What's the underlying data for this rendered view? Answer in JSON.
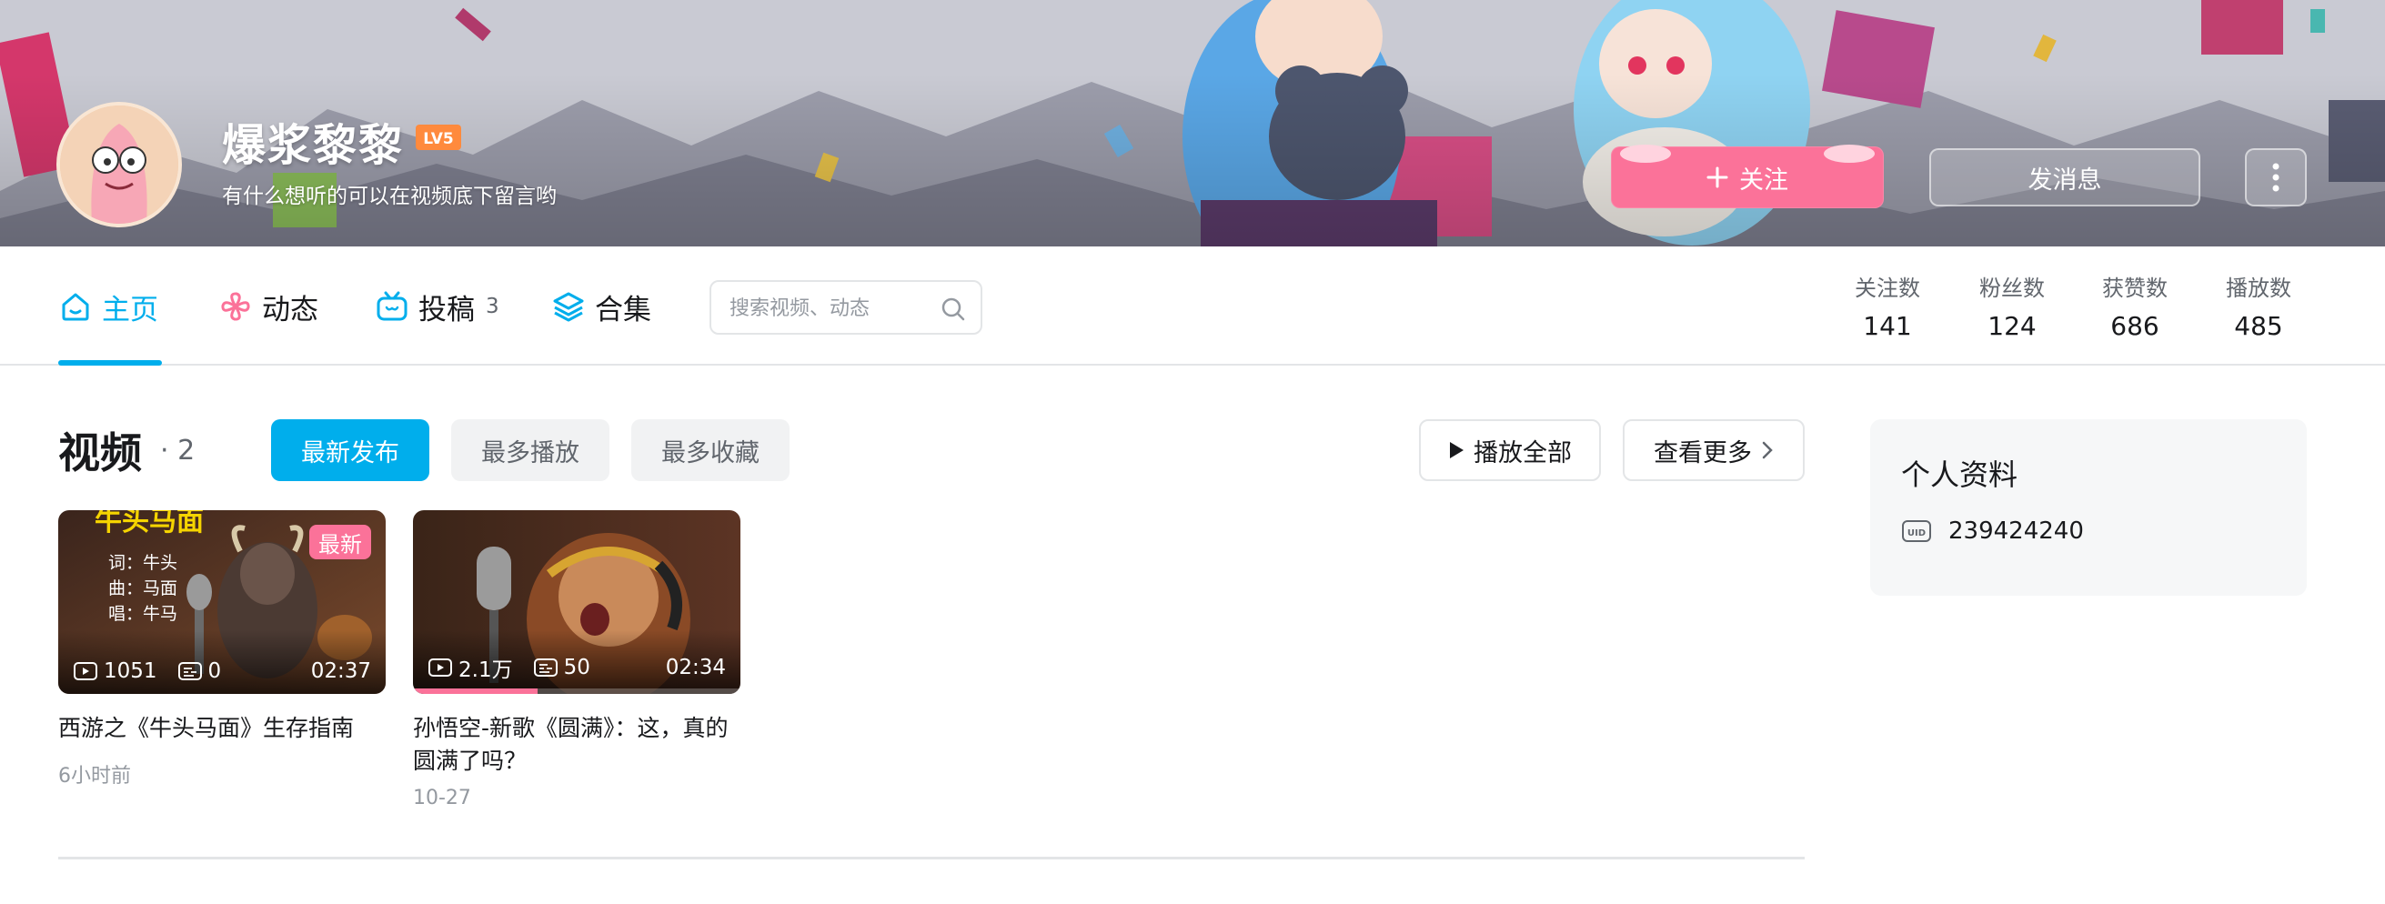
{
  "header": {
    "username": "爆浆黎黎",
    "level": "LV5",
    "signature": "有什么想听的可以在视频底下留言哟",
    "follow_label": "关注",
    "message_label": "发消息"
  },
  "nav": {
    "tabs": [
      {
        "label": "主页",
        "icon": "home-icon"
      },
      {
        "label": "动态",
        "icon": "pinwheel-icon"
      },
      {
        "label": "投稿",
        "icon": "tv-icon",
        "count": "3"
      },
      {
        "label": "合集",
        "icon": "layers-icon"
      }
    ],
    "search_placeholder": "搜索视频、动态",
    "stats": [
      {
        "label": "关注数",
        "value": "141"
      },
      {
        "label": "粉丝数",
        "value": "124"
      },
      {
        "label": "获赞数",
        "value": "686"
      },
      {
        "label": "播放数",
        "value": "485"
      }
    ]
  },
  "videos": {
    "title": "视频",
    "count": "· 2",
    "sort_options": [
      "最新发布",
      "最多播放",
      "最多收藏"
    ],
    "play_all_label": "播放全部",
    "see_more_label": "查看更多",
    "items": [
      {
        "title": "西游之《牛头马面》生存指南",
        "plays": "1051",
        "danmaku": "0",
        "duration": "02:37",
        "date": "6小时前",
        "badge": "最新",
        "cover_text": {
          "top": "牛头马面",
          "lines": [
            "词：牛头",
            "曲：马面",
            "唱：牛马"
          ]
        }
      },
      {
        "title": "孙悟空-新歌《圆满》：这，真的圆满了吗？",
        "plays": "2.1万",
        "danmaku": "50",
        "duration": "02:34",
        "date": "10-27",
        "watch_progress": 0.38
      }
    ]
  },
  "profile": {
    "title": "个人资料",
    "uid": "239424240"
  },
  "colors": {
    "accent": "#00aeec",
    "pink": "#fb7299",
    "text_secondary": "#61666d"
  }
}
